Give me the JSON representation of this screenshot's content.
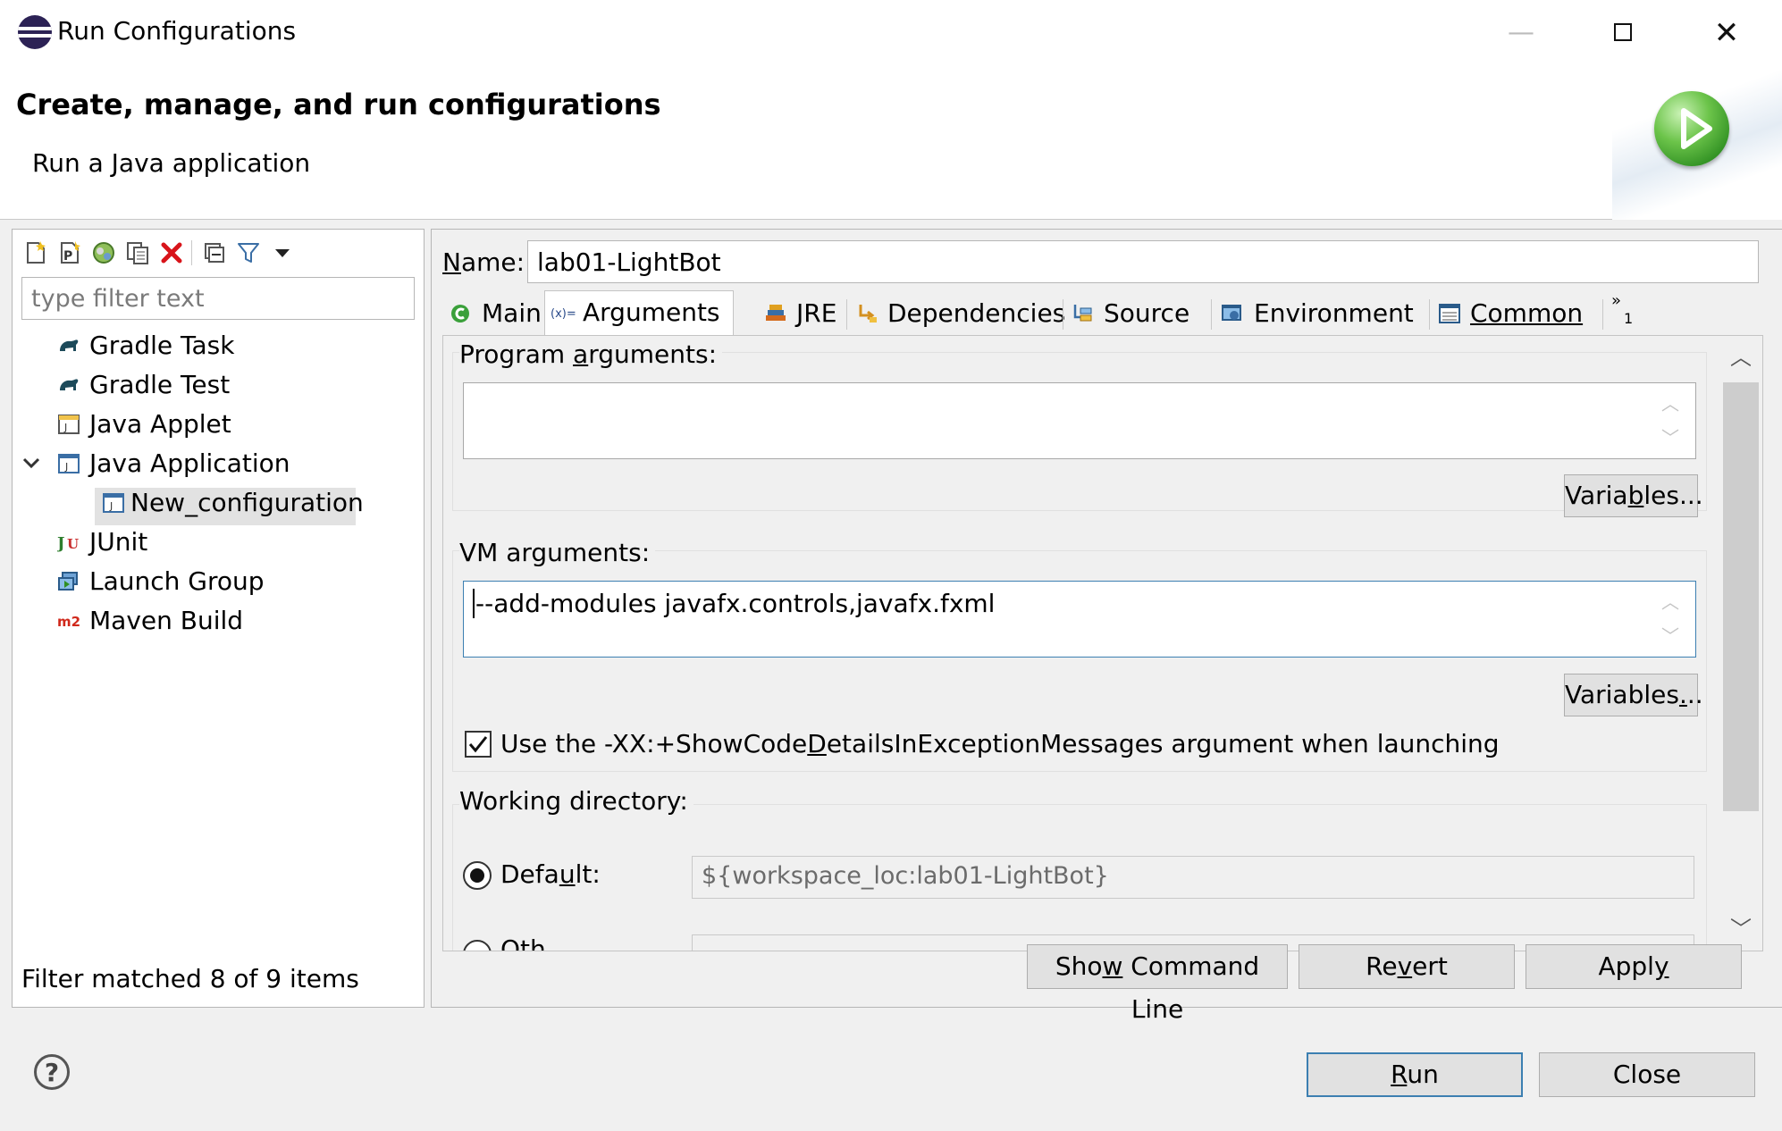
{
  "window": {
    "title": "Run Configurations"
  },
  "header": {
    "title": "Create, manage, and run configurations",
    "subtitle": "Run a Java application",
    "icon": "run-launch-icon"
  },
  "left_panel": {
    "toolbar_icons": [
      "new-configuration-icon",
      "new-prototype-icon",
      "export-icon",
      "duplicate-icon",
      "delete-icon",
      "collapse-all-icon",
      "filter-icon",
      "view-menu-icon"
    ],
    "filter_placeholder": "type filter text",
    "tree": [
      {
        "label": "Gradle Task",
        "icon": "gradle-icon"
      },
      {
        "label": "Gradle Test",
        "icon": "gradle-icon"
      },
      {
        "label": "Java Applet",
        "icon": "java-applet-icon"
      },
      {
        "label": "Java Application",
        "icon": "java-application-icon",
        "expanded": true
      },
      {
        "label": "New_configuration",
        "icon": "java-application-icon",
        "selected": true
      },
      {
        "label": "JUnit",
        "icon": "junit-icon"
      },
      {
        "label": "Launch Group",
        "icon": "launch-group-icon"
      },
      {
        "label": "Maven Build",
        "icon": "maven-icon"
      }
    ],
    "status": "Filter matched 8 of 9 items"
  },
  "right_panel": {
    "name_label_n": "N",
    "name_label_rest": "ame:",
    "name_value": "lab01-LightBot",
    "tabs": [
      {
        "label": "Main",
        "icon": "main-tab-icon"
      },
      {
        "label": "Arguments",
        "icon": "arguments-tab-icon",
        "active": true
      },
      {
        "label": "JRE",
        "icon": "jre-tab-icon"
      },
      {
        "label": "Dependencies",
        "icon": "dependencies-tab-icon"
      },
      {
        "label": "Source",
        "icon": "source-tab-icon"
      },
      {
        "label": "Environment",
        "icon": "environment-tab-icon"
      },
      {
        "label": "Common",
        "icon": "common-tab-icon"
      }
    ],
    "overflow_tab_count": "1",
    "program_args": {
      "label_pre": "Program ",
      "label_u": "a",
      "label_post": "rguments:",
      "value": "",
      "variables_pre": "Varia",
      "variables_u": "b",
      "variables_post": "les..."
    },
    "vm_args": {
      "label": "VM arguments:",
      "value": "--add-modules javafx.controls,javafx.fxml",
      "variables_pre": "Variables",
      "variables_u": ".",
      "variables_post": ".."
    },
    "show_code_details": {
      "checked": true,
      "label_pre": "Use the -XX:+ShowCode",
      "label_u": "D",
      "label_post": "etailsInExceptionMessages argument when launching"
    },
    "working_directory": {
      "label": "Working directory:",
      "default_label_pre": "Defa",
      "default_label_u": "u",
      "default_label_post": "lt:",
      "default_value": "${workspace_loc:lab01-LightBot}",
      "other_label": "Oth"
    },
    "buttons": {
      "show_cmd_pre": "Sho",
      "show_cmd_u": "w",
      "show_cmd_post": " Command Line",
      "revert_pre": "Re",
      "revert_u": "v",
      "revert_post": "ert",
      "apply_pre": "Appl",
      "apply_u": "y",
      "apply_post": ""
    }
  },
  "footer": {
    "help_icon": "help-icon",
    "run_u": "R",
    "run_post": "un",
    "close": "Close"
  }
}
